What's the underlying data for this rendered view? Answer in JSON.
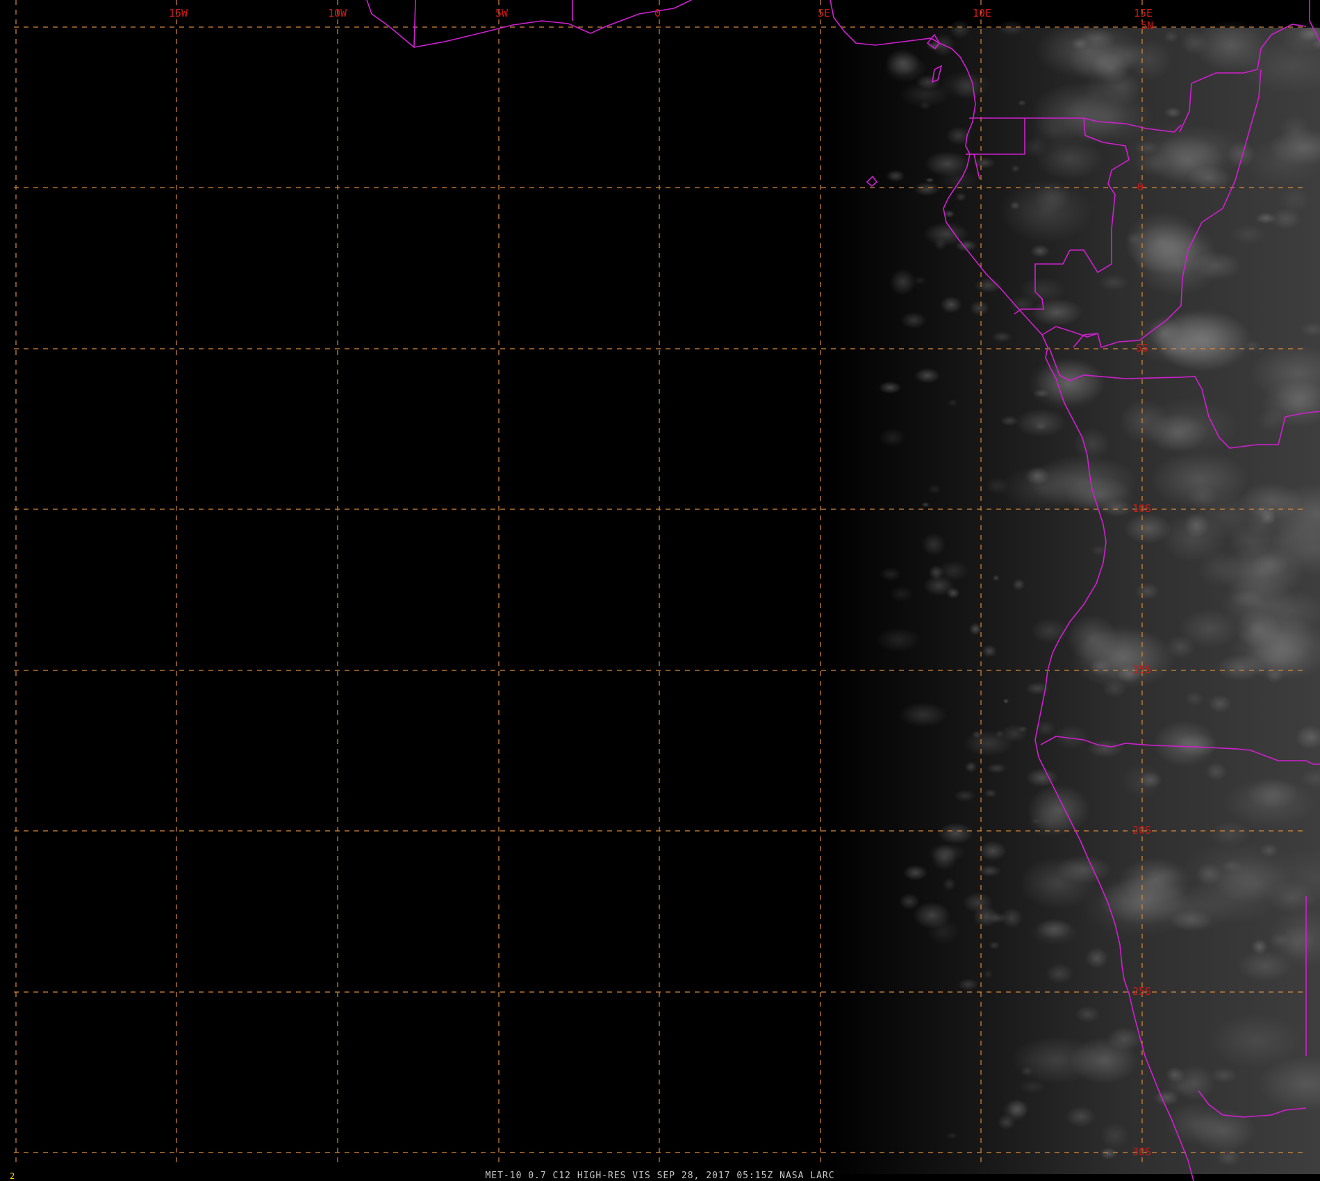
{
  "imagery": {
    "longitude_labels": [
      "15W",
      "10W",
      "5W",
      "0",
      "5E",
      "10E",
      "15E"
    ],
    "latitude_labels": [
      "5N",
      "0",
      "5S",
      "10S",
      "15S",
      "20S",
      "25S",
      "30S"
    ],
    "footer": "MET-10 0.7 C12 HIGH-RES VIS   SEP 28, 2017 05:15Z   NASA LARC",
    "frame_number": "2"
  },
  "colors": {
    "background": "#000000",
    "grid": "#d98a3a",
    "borders": "#d020d0",
    "labels": "#d01818",
    "frame_number": "#ffd400"
  }
}
